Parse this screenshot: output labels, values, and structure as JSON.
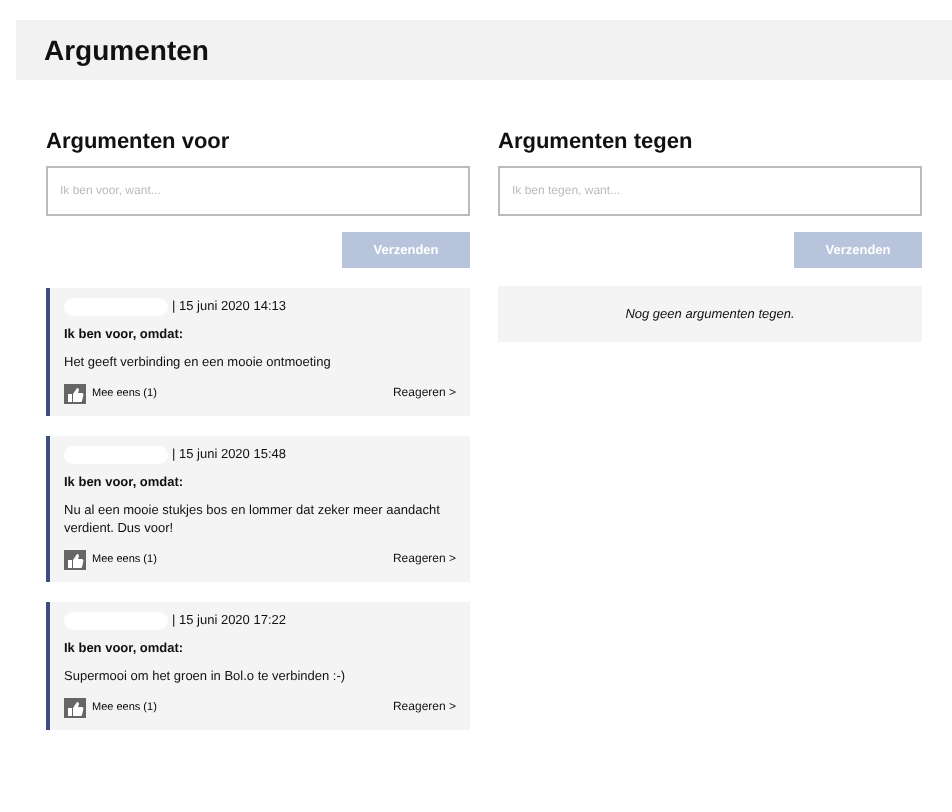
{
  "page": {
    "title": "Argumenten"
  },
  "columns": [
    {
      "heading": "Argumenten voor",
      "placeholder": "Ik ben voor, want...",
      "button": "Verzenden",
      "arguments": [
        {
          "date": "| 15 juni 2020 14:13",
          "stance": "Ik ben voor, omdat:",
          "text": "Het geeft verbinding en een mooie ontmoeting",
          "agree": "Mee eens (1)",
          "reply": "Reageren >"
        },
        {
          "date": "| 15 juni 2020 15:48",
          "stance": "Ik ben voor, omdat:",
          "text": "Nu al een mooie stukjes bos en lommer dat zeker meer aandacht verdient. Dus voor!",
          "agree": "Mee eens (1)",
          "reply": "Reageren >"
        },
        {
          "date": "| 15 juni 2020 17:22",
          "stance": "Ik ben voor, omdat:",
          "text": "Supermooi om het groen in Bol.o te verbinden :-)",
          "agree": "Mee eens (1)",
          "reply": "Reageren >"
        }
      ]
    },
    {
      "heading": "Argumenten tegen",
      "placeholder": "Ik ben tegen, want...",
      "button": "Verzenden",
      "empty_message": "Nog geen argumenten tegen."
    }
  ]
}
